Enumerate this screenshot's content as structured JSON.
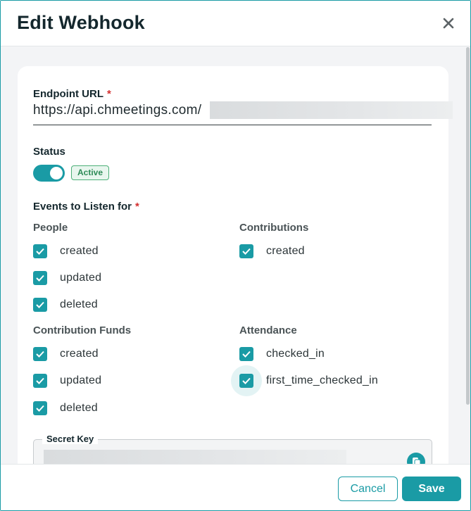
{
  "dialog": {
    "title": "Edit Webhook"
  },
  "form": {
    "endpoint_label": "Endpoint URL",
    "required_mark": "*",
    "endpoint_value": "https://api.chmeetings.com/",
    "status_label": "Status",
    "status_enabled": true,
    "status_badge": "Active",
    "events_label": "Events to Listen for",
    "groups": {
      "people": {
        "title": "People",
        "items": [
          {
            "label": "created",
            "checked": true
          },
          {
            "label": "updated",
            "checked": true
          },
          {
            "label": "deleted",
            "checked": true
          }
        ]
      },
      "contributions": {
        "title": "Contributions",
        "items": [
          {
            "label": "created",
            "checked": true
          }
        ]
      },
      "contribution_funds": {
        "title": "Contribution Funds",
        "items": [
          {
            "label": "created",
            "checked": true
          },
          {
            "label": "updated",
            "checked": true
          },
          {
            "label": "deleted",
            "checked": true
          }
        ]
      },
      "attendance": {
        "title": "Attendance",
        "items": [
          {
            "label": "checked_in",
            "checked": true
          },
          {
            "label": "first_time_checked_in",
            "checked": true
          }
        ]
      }
    },
    "secret_key_label": "Secret Key"
  },
  "footer": {
    "cancel_label": "Cancel",
    "save_label": "Save"
  },
  "colors": {
    "accent": "#1a9ba5",
    "required": "#d32f2f",
    "active_badge": "#2e8b57"
  },
  "icons": {
    "close": "close-icon",
    "check": "check-icon",
    "copy": "copy-icon"
  }
}
